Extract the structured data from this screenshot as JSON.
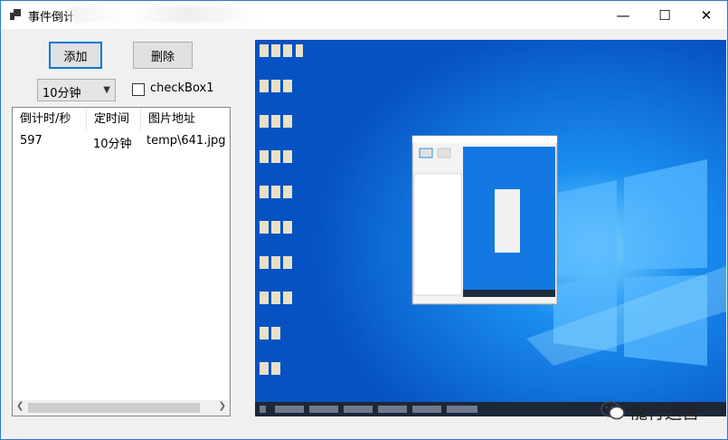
{
  "window": {
    "title": "事件倒计",
    "controls": {
      "minimize": "—",
      "maximize": "☐",
      "close": "✕"
    }
  },
  "toolbar": {
    "add_label": "添加",
    "delete_label": "删除"
  },
  "timer_select": {
    "selected": "10分钟"
  },
  "checkbox": {
    "label": "checkBox1",
    "checked": false
  },
  "listview": {
    "columns": [
      "倒计时/秒",
      "定时间",
      "图片地址"
    ],
    "rows": [
      {
        "countdown": "597",
        "time": "10分钟",
        "path": "temp\\641.jpg"
      }
    ]
  },
  "watermark": {
    "text": "龍行运营"
  },
  "colors": {
    "accent": "#0078d7",
    "desktop": "#0a5fcf",
    "window_border": "#2b79d1"
  }
}
